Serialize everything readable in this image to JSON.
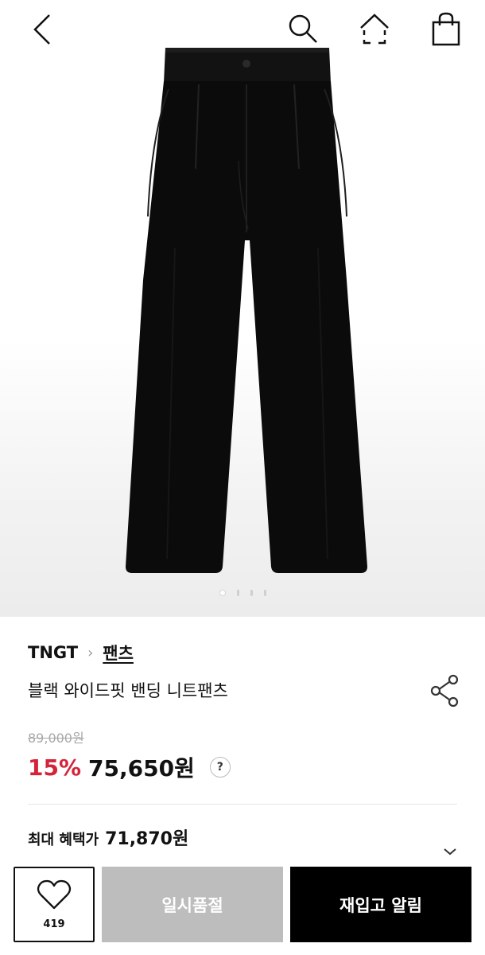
{
  "header": {
    "back_icon": "chevron-left-icon",
    "search_icon": "search-icon",
    "home_icon": "home-icon",
    "cart_icon": "shopping-bag-icon"
  },
  "gallery": {
    "image": "black-wide-pants-photo",
    "slide_count": 4,
    "active_slide": 1
  },
  "product": {
    "brand": "TNGT",
    "category": "팬츠",
    "name": "블랙 와이드핏 밴딩 니트팬츠",
    "original_price": "89,000원",
    "discount": "15%",
    "price": "75,650원",
    "help_icon_label": "?",
    "benefit_label": "최대 혜택가",
    "benefit_price": "71,870원"
  },
  "bottom_bar": {
    "like_count": "419",
    "soldout_label": "일시품절",
    "restock_label": "재입고 알림"
  },
  "colors": {
    "discount_red": "#d4243a",
    "soldout_gray": "#bdbdbd",
    "primary_black": "#000000"
  }
}
